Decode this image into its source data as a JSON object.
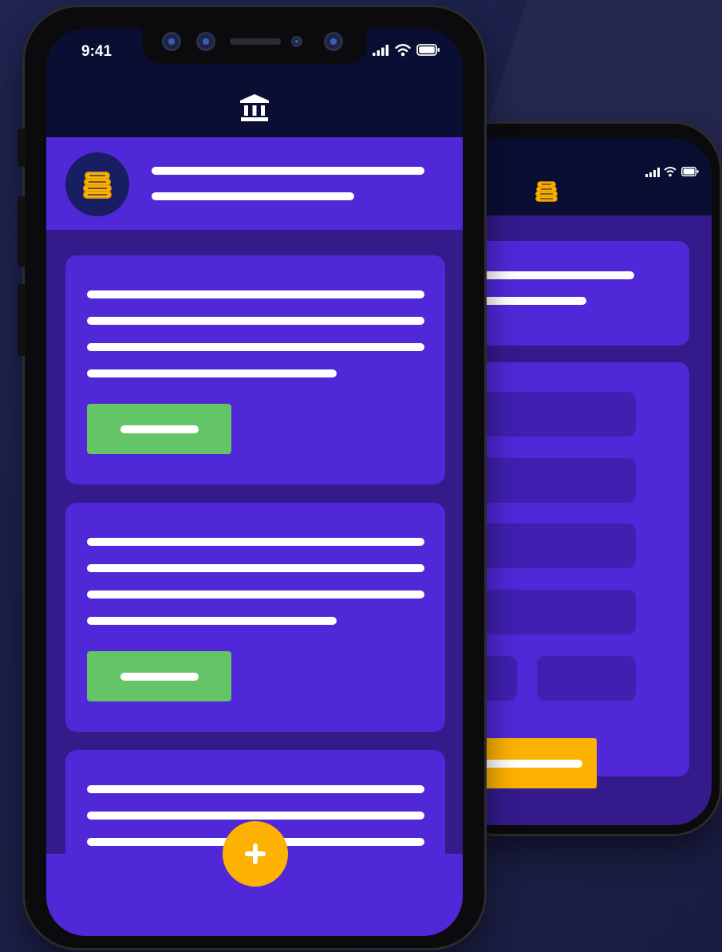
{
  "status_bar": {
    "time": "9:41"
  },
  "colors": {
    "background": "#1d2148",
    "header": "#0a0e33",
    "card": "#5028d8",
    "screen": "#331b8c",
    "field": "#3f20b0",
    "primary_button": "#63c565",
    "accent": "#fdb100"
  },
  "icons": {
    "header_front": "bank-icon",
    "header_back": "coins-icon",
    "avatar": "coins-icon",
    "fab": "plus-icon",
    "status": [
      "signal-icon",
      "wifi-icon",
      "battery-icon"
    ]
  },
  "front_screen": {
    "cards": [
      {
        "text_lines": 4,
        "has_button": true
      },
      {
        "text_lines": 4,
        "has_button": true
      },
      {
        "text_lines": 3,
        "has_button": false
      }
    ]
  },
  "back_screen": {
    "form_fields": 6
  }
}
